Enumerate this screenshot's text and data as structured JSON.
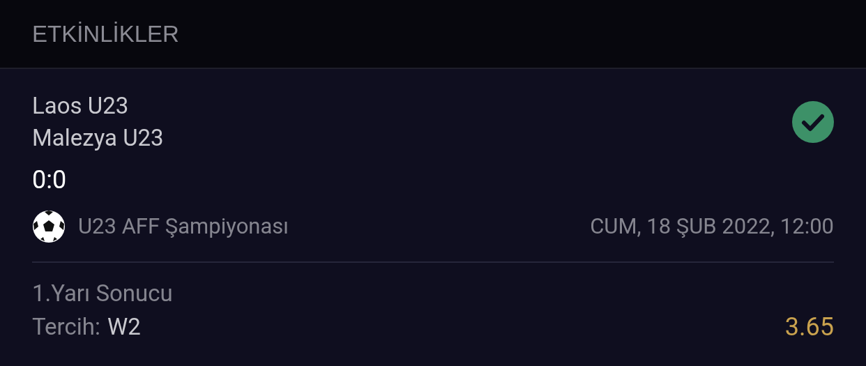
{
  "header": {
    "title": "ETKİNLİKLER"
  },
  "event": {
    "home": "Laos U23",
    "away": "Malezya U23",
    "won": true,
    "score": "0:0",
    "league": "U23 AFF Şampiyonası",
    "date": "CUM, 18 ŞUB 2022, 12:00"
  },
  "bet": {
    "market": "1.Yarı Sonucu",
    "choice_label": "Tercih:",
    "choice": "W2",
    "odds": "3.65"
  }
}
